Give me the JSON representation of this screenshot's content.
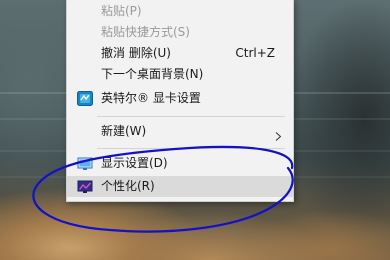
{
  "context_menu": {
    "items": [
      {
        "label": "粘贴(P)",
        "shortcut": "",
        "enabled": false
      },
      {
        "label": "粘贴快捷方式(S)",
        "shortcut": "",
        "enabled": false
      },
      {
        "label": "撤消 删除(U)",
        "shortcut": "Ctrl+Z",
        "enabled": true
      },
      {
        "label": "下一个桌面背景(N)",
        "shortcut": "",
        "enabled": true
      },
      {
        "label": "英特尔® 显卡设置",
        "shortcut": "",
        "enabled": true,
        "icon": "intel-graphics-icon"
      },
      {
        "label": "新建(W)",
        "shortcut": "",
        "enabled": true,
        "submenu": true
      },
      {
        "label": "显示设置(D)",
        "shortcut": "",
        "enabled": true,
        "icon": "display-settings-icon"
      },
      {
        "label": "个性化(R)",
        "shortcut": "",
        "enabled": true,
        "icon": "personalize-icon",
        "highlighted": true
      }
    ]
  },
  "colors": {
    "menu_background": "#f2f2f2",
    "highlight": "#dadada",
    "disabled_text": "#9a9a9a",
    "annotation_stroke": "#1212c8"
  }
}
